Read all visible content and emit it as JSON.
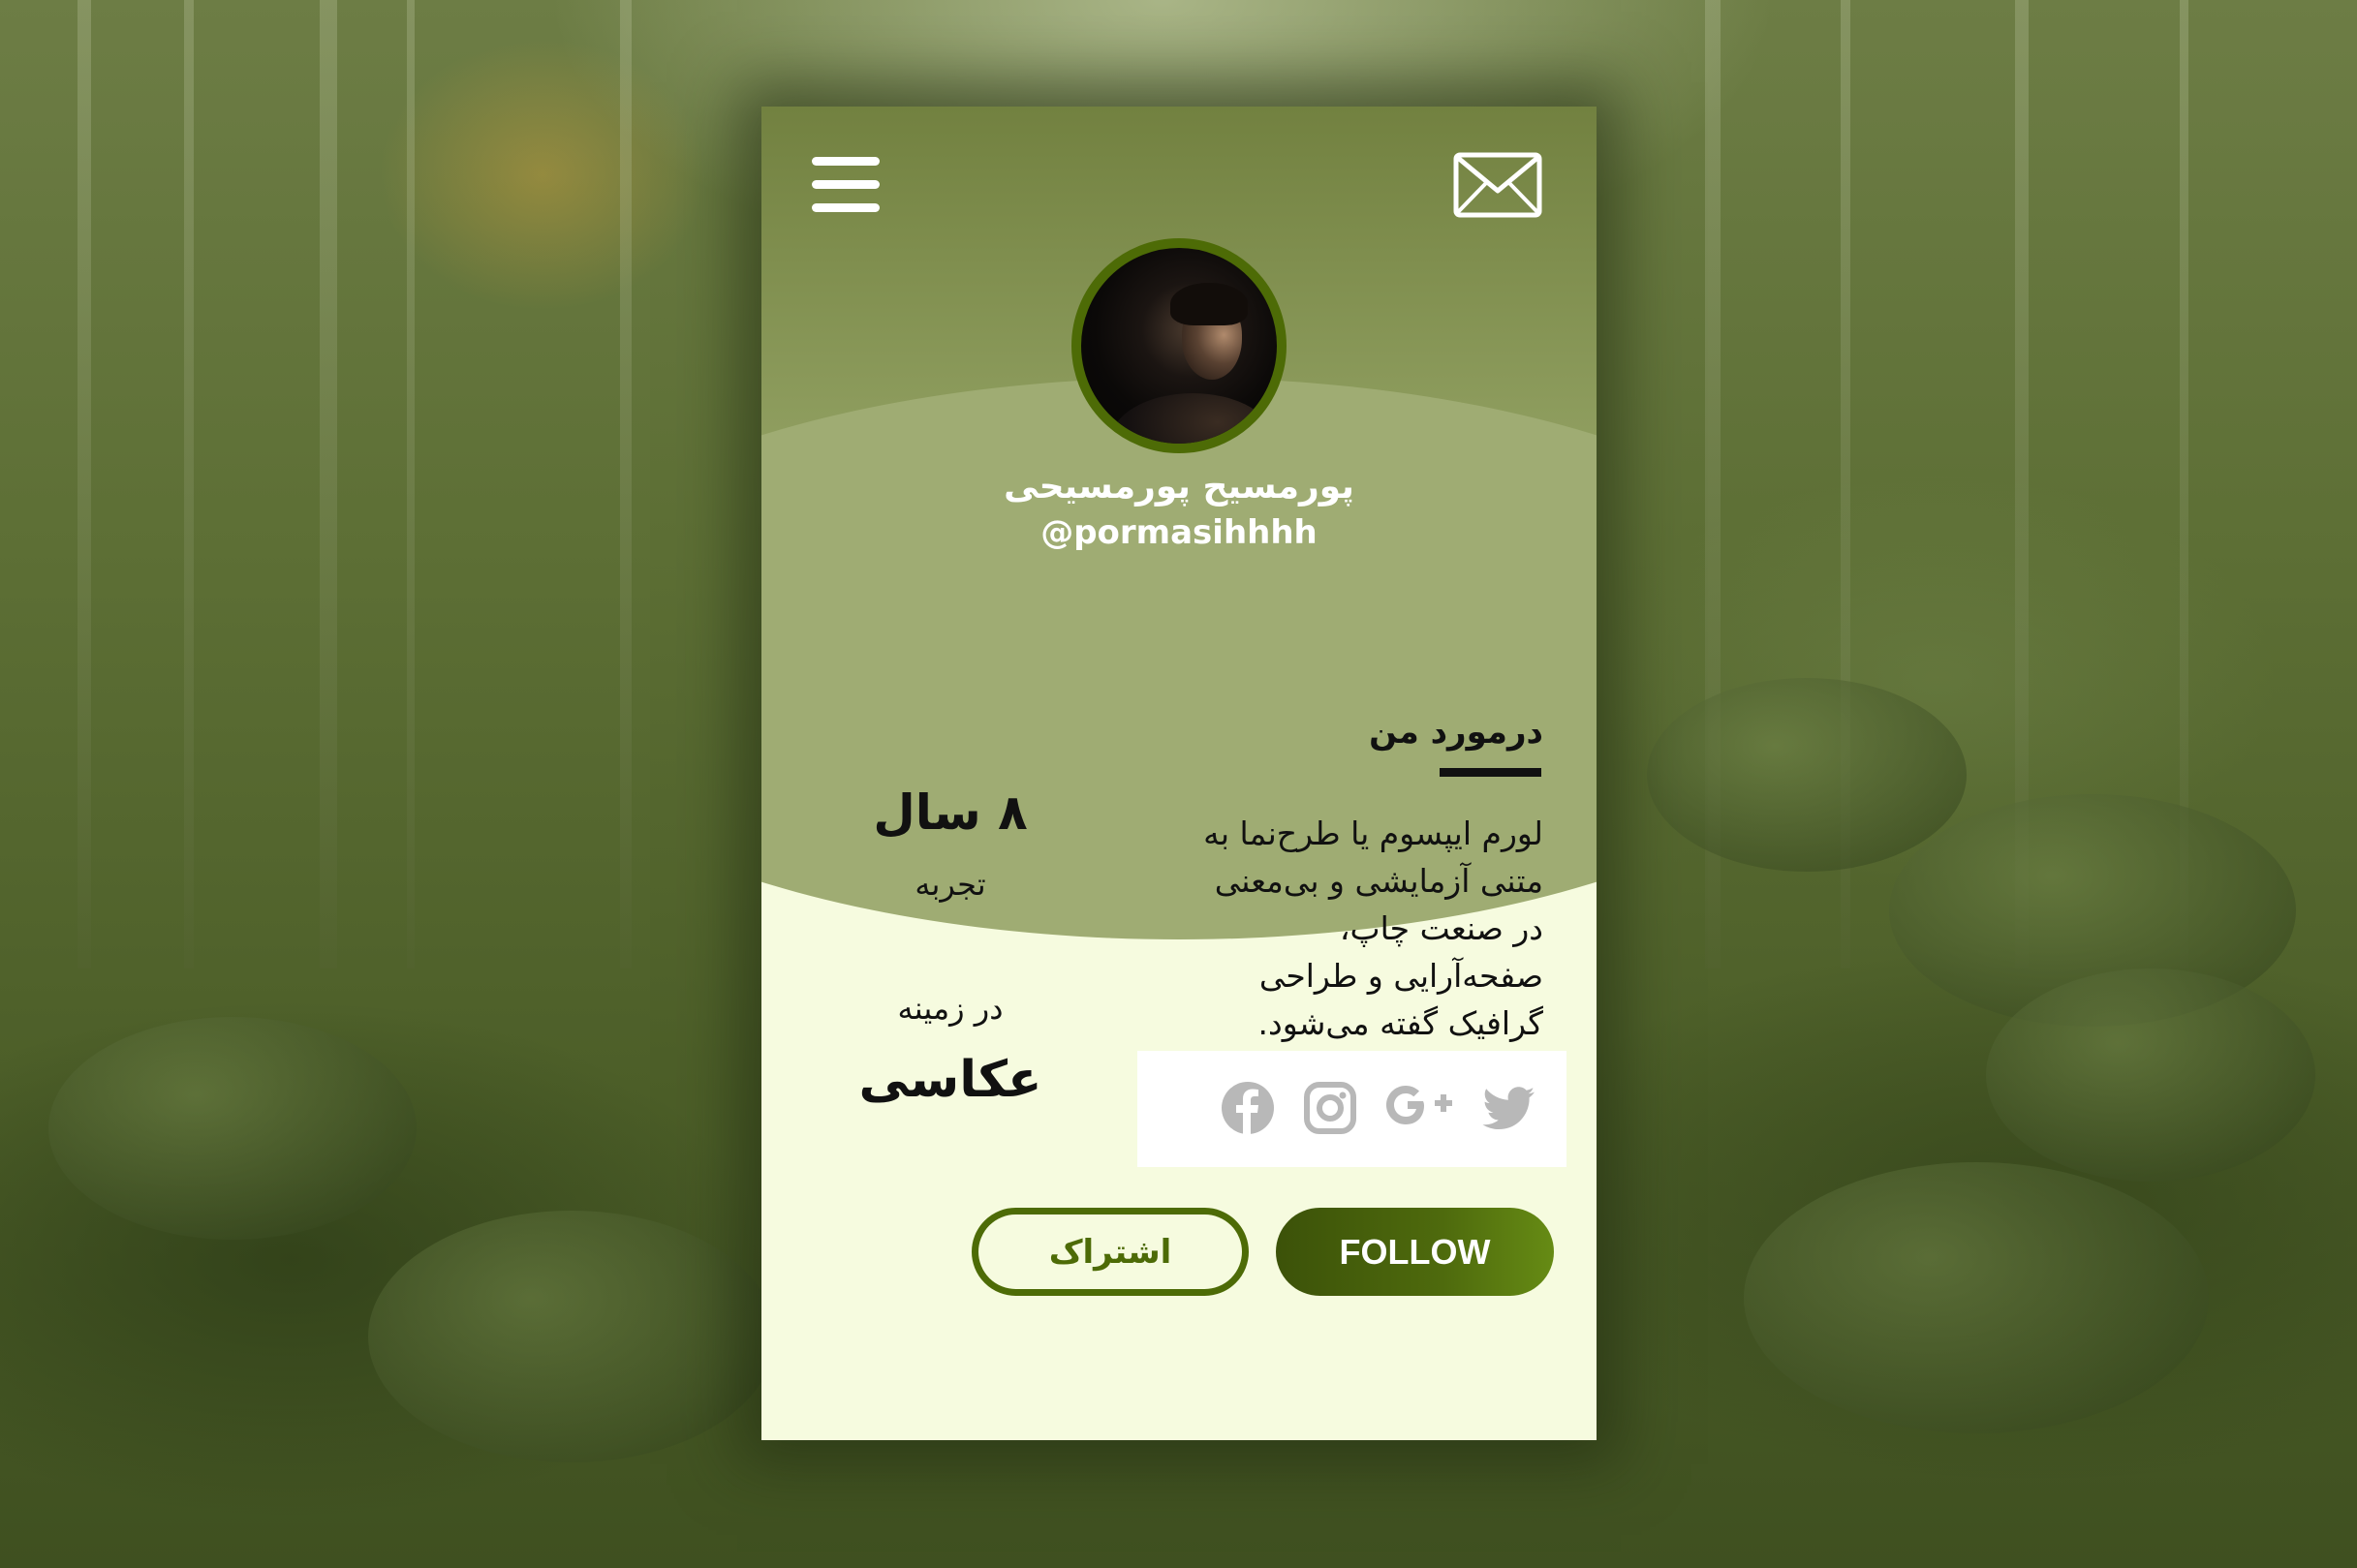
{
  "profile": {
    "name": "پورمسیح پورمسیحی",
    "username": "@pormasihhhh"
  },
  "about": {
    "title": "درمورد من",
    "lines": [
      "لورم ایپسوم یا طرح‌نما به",
      "متنی آزمایشی و بی‌معنی",
      "در صنعت چاپ،",
      "صفحه‌آرایی و طراحی",
      "گرافیک گفته می‌شود."
    ]
  },
  "stats": {
    "years": "۸ سال",
    "experience_label": "تجربه",
    "field_label": "در زمینه",
    "field": "عکاسی"
  },
  "social": {
    "icons": [
      "facebook-icon",
      "instagram-icon",
      "google-plus-icon",
      "twitter-icon"
    ],
    "color": "#b8b8b8"
  },
  "buttons": {
    "follow": "FOLLOW",
    "share": "اشتراک"
  },
  "colors": {
    "accent": "#4d6b06",
    "header": "#8d9c5d",
    "card_bg": "#f6fbdf"
  }
}
